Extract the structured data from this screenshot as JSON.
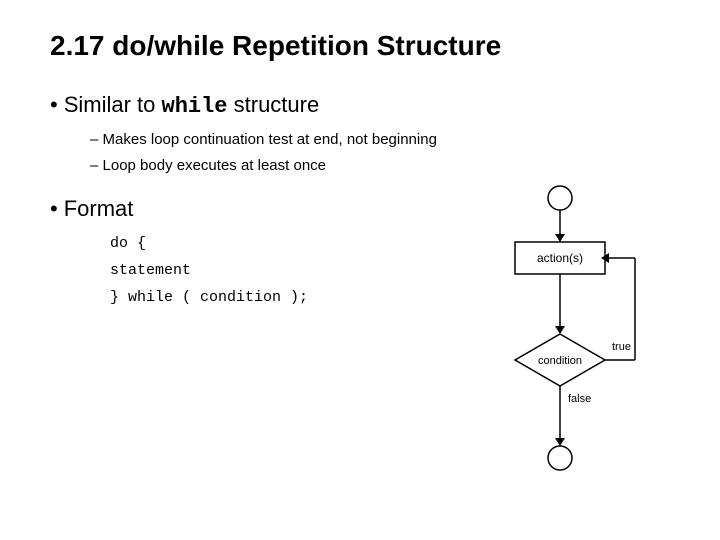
{
  "title": "2.17   do/while Repetition Structure",
  "bullets": [
    {
      "main_prefix": "Similar to ",
      "main_mono": "while",
      "main_suffix": " structure",
      "subs": [
        "Makes loop continuation test at end, not beginning",
        "Loop body executes at least once"
      ]
    },
    {
      "main_text": "Format",
      "code_lines": [
        "do {",
        "    statement",
        "} while ( condition );"
      ]
    }
  ],
  "flowchart": {
    "action_label": "action(s)",
    "condition_label": "condition",
    "true_label": "true",
    "false_label": "false"
  }
}
